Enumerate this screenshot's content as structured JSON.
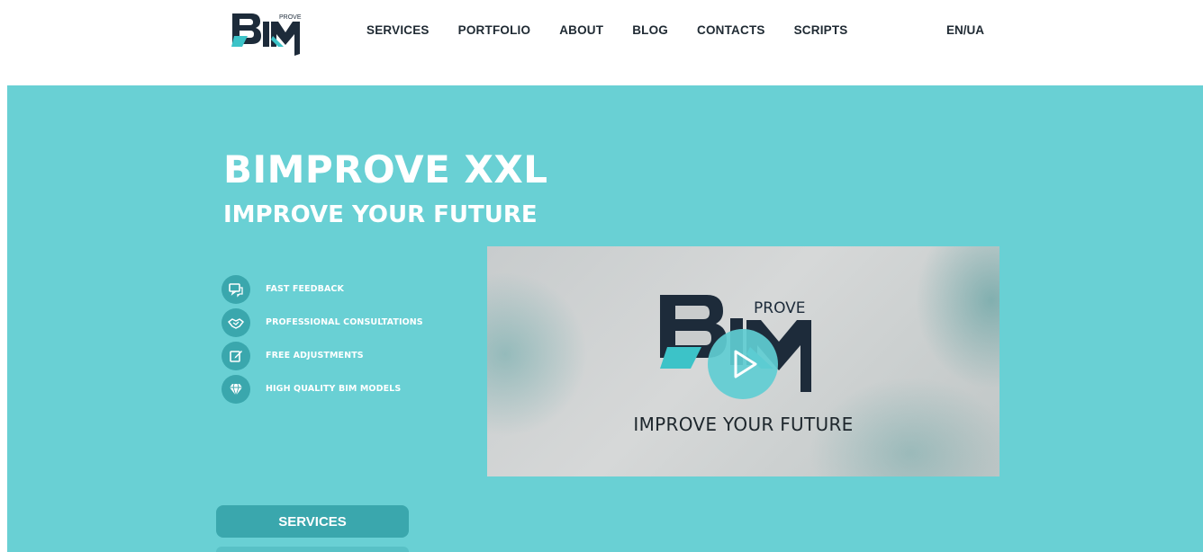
{
  "header": {
    "logo": {
      "letters": "BIM",
      "superscript": "PROVE"
    },
    "nav": [
      {
        "label": "SERVICES"
      },
      {
        "label": "PORTFOLIO"
      },
      {
        "label": "ABOUT"
      },
      {
        "label": "BLOG"
      },
      {
        "label": "CONTACTS"
      },
      {
        "label": "SCRIPTS"
      }
    ],
    "language": "EN/UA"
  },
  "hero": {
    "title": "BIMPROVE XXL",
    "subtitle": "IMPROVE YOUR FUTURE",
    "features": [
      {
        "icon": "chat-icon",
        "label": "FAST FEEDBACK"
      },
      {
        "icon": "handshake-icon",
        "label": "PROFESSIONAL CONSULTATIONS"
      },
      {
        "icon": "edit-icon",
        "label": "FREE ADJUSTMENTS"
      },
      {
        "icon": "diamond-icon",
        "label": "HIGH QUALITY BIM MODELS"
      }
    ],
    "video": {
      "logo_superscript": "PROVE",
      "tagline": "IMPROVE  YOUR FUTURE",
      "play_icon": "play-icon"
    },
    "cta": {
      "services_label": "SERVICES"
    }
  },
  "colors": {
    "hero_bg": "#69d0d4",
    "accent": "#3aa7ad",
    "nav_text": "#1f2a33",
    "logo_dark": "#1d2b3a",
    "logo_teal": "#3cc3c8"
  }
}
